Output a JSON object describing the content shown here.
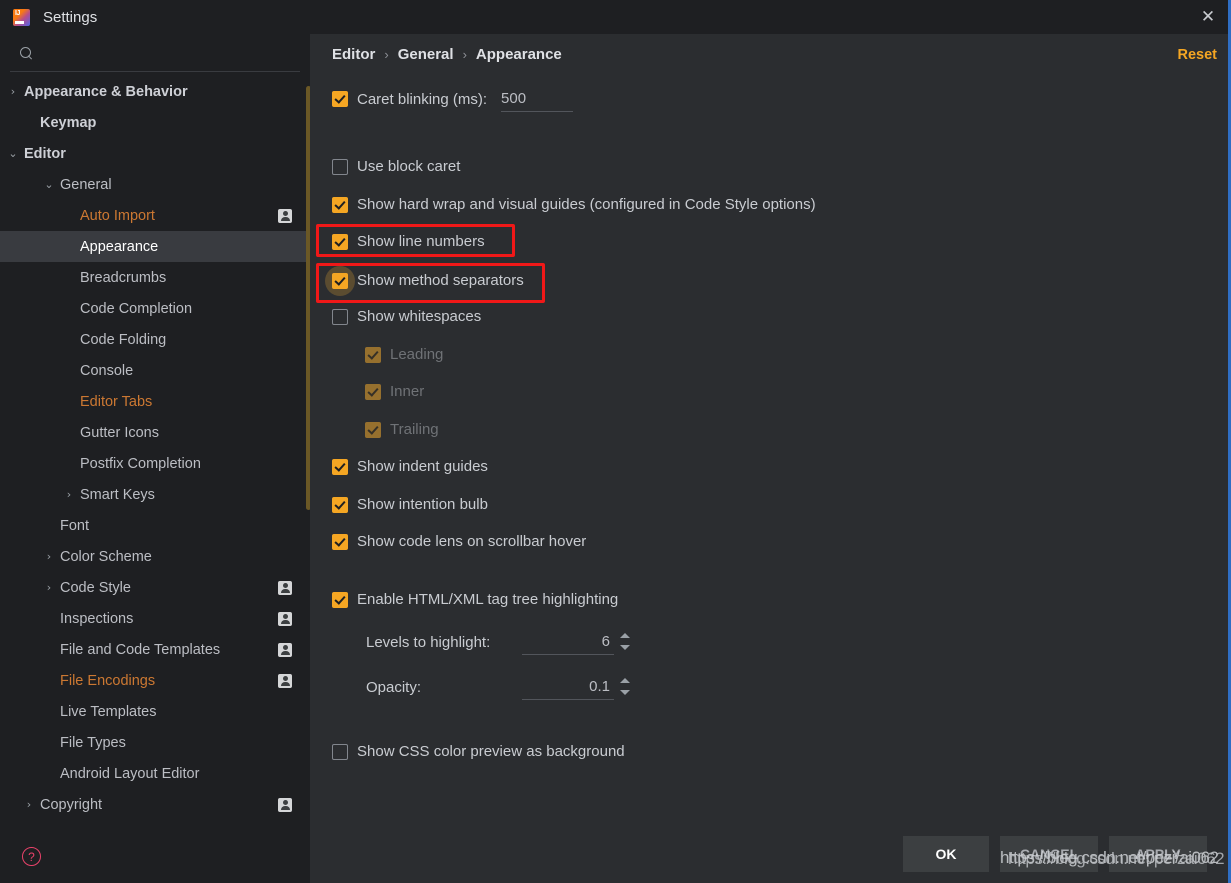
{
  "window": {
    "title": "Settings",
    "app_icon": "intellij-idea-icon",
    "close_icon": "close-icon"
  },
  "sidebar": {
    "search": {
      "value": "",
      "placeholder": "",
      "icon": "search-icon"
    },
    "help_icon": "help-circle-icon",
    "items": [
      {
        "label": "Appearance & Behavior",
        "indent": 24,
        "arrow": "›",
        "bold": true,
        "state": "normal",
        "badge": false,
        "selected": false
      },
      {
        "label": "Keymap",
        "indent": 40,
        "arrow": "",
        "bold": true,
        "state": "normal",
        "badge": false,
        "selected": false
      },
      {
        "label": "Editor",
        "indent": 24,
        "arrow": "⌄",
        "bold": true,
        "state": "normal",
        "badge": false,
        "selected": false
      },
      {
        "label": "General",
        "indent": 60,
        "arrow": "⌄",
        "bold": false,
        "state": "normal",
        "badge": false,
        "selected": false
      },
      {
        "label": "Auto Import",
        "indent": 80,
        "arrow": "",
        "bold": false,
        "state": "modified",
        "badge": true,
        "selected": false
      },
      {
        "label": "Appearance",
        "indent": 80,
        "arrow": "",
        "bold": false,
        "state": "normal",
        "badge": false,
        "selected": true
      },
      {
        "label": "Breadcrumbs",
        "indent": 80,
        "arrow": "",
        "bold": false,
        "state": "normal",
        "badge": false,
        "selected": false
      },
      {
        "label": "Code Completion",
        "indent": 80,
        "arrow": "",
        "bold": false,
        "state": "normal",
        "badge": false,
        "selected": false
      },
      {
        "label": "Code Folding",
        "indent": 80,
        "arrow": "",
        "bold": false,
        "state": "normal",
        "badge": false,
        "selected": false
      },
      {
        "label": "Console",
        "indent": 80,
        "arrow": "",
        "bold": false,
        "state": "normal",
        "badge": false,
        "selected": false
      },
      {
        "label": "Editor Tabs",
        "indent": 80,
        "arrow": "",
        "bold": false,
        "state": "modified",
        "badge": false,
        "selected": false
      },
      {
        "label": "Gutter Icons",
        "indent": 80,
        "arrow": "",
        "bold": false,
        "state": "normal",
        "badge": false,
        "selected": false
      },
      {
        "label": "Postfix Completion",
        "indent": 80,
        "arrow": "",
        "bold": false,
        "state": "normal",
        "badge": false,
        "selected": false
      },
      {
        "label": "Smart Keys",
        "indent": 80,
        "arrow": "›",
        "bold": false,
        "state": "normal",
        "badge": false,
        "selected": false
      },
      {
        "label": "Font",
        "indent": 60,
        "arrow": "",
        "bold": false,
        "state": "normal",
        "badge": false,
        "selected": false
      },
      {
        "label": "Color Scheme",
        "indent": 60,
        "arrow": "›",
        "bold": false,
        "state": "normal",
        "badge": false,
        "selected": false
      },
      {
        "label": "Code Style",
        "indent": 60,
        "arrow": "›",
        "bold": false,
        "state": "normal",
        "badge": true,
        "selected": false
      },
      {
        "label": "Inspections",
        "indent": 60,
        "arrow": "",
        "bold": false,
        "state": "normal",
        "badge": true,
        "selected": false
      },
      {
        "label": "File and Code Templates",
        "indent": 60,
        "arrow": "",
        "bold": false,
        "state": "normal",
        "badge": true,
        "selected": false
      },
      {
        "label": "File Encodings",
        "indent": 60,
        "arrow": "",
        "bold": false,
        "state": "modified",
        "badge": true,
        "selected": false
      },
      {
        "label": "Live Templates",
        "indent": 60,
        "arrow": "",
        "bold": false,
        "state": "normal",
        "badge": false,
        "selected": false
      },
      {
        "label": "File Types",
        "indent": 60,
        "arrow": "",
        "bold": false,
        "state": "normal",
        "badge": false,
        "selected": false
      },
      {
        "label": "Android Layout Editor",
        "indent": 60,
        "arrow": "",
        "bold": false,
        "state": "normal",
        "badge": false,
        "selected": false
      },
      {
        "label": "Copyright",
        "indent": 40,
        "arrow": "›",
        "bold": false,
        "state": "normal",
        "badge": true,
        "selected": false
      }
    ]
  },
  "main": {
    "breadcrumb": {
      "parts": [
        "Editor",
        "General",
        "Appearance"
      ],
      "separator": "›"
    },
    "reset_label": "Reset",
    "caret_blinking": {
      "label": "Caret blinking (ms):",
      "checked": true,
      "value": "500"
    },
    "options": [
      {
        "label": "Use block caret",
        "checked": false,
        "disabled": false
      },
      {
        "label": "Show hard wrap and visual guides (configured in Code Style options)",
        "checked": true,
        "disabled": false
      },
      {
        "label": "Show line numbers",
        "checked": true,
        "disabled": false,
        "highlighted": true
      },
      {
        "label": "Show method separators",
        "checked": true,
        "disabled": false,
        "highlighted": true,
        "focused": true
      },
      {
        "label": "Show whitespaces",
        "checked": false,
        "disabled": false
      },
      {
        "label": "Leading",
        "checked": true,
        "disabled": true
      },
      {
        "label": "Inner",
        "checked": true,
        "disabled": true
      },
      {
        "label": "Trailing",
        "checked": true,
        "disabled": true
      },
      {
        "label": "Show indent guides",
        "checked": true,
        "disabled": false
      },
      {
        "label": "Show intention bulb",
        "checked": true,
        "disabled": false
      },
      {
        "label": "Show code lens on scrollbar hover",
        "checked": true,
        "disabled": false
      }
    ],
    "html_xml": {
      "enable_label": "Enable HTML/XML tag tree highlighting",
      "enable_checked": true,
      "levels_label": "Levels to highlight:",
      "levels_value": "6",
      "opacity_label": "Opacity:",
      "opacity_value": "0.1"
    },
    "css_preview": {
      "label": "Show CSS color preview as background",
      "checked": false
    }
  },
  "footer": {
    "ok": "OK",
    "cancel": "CANCEL",
    "apply": "APPLY",
    "watermark_a": "https://blog.csdn.net/pezi/ai062",
    "watermark_b": "https://blog.csdn.net/perzai062"
  },
  "colors": {
    "accent": "#f5a623",
    "highlight_box": "#f01818",
    "selection": "#393b40",
    "modified_text": "#cc7832",
    "window_bg": "#2b2d30",
    "sidebar_bg": "#1e1f22",
    "help_icon": "#e8426a"
  }
}
